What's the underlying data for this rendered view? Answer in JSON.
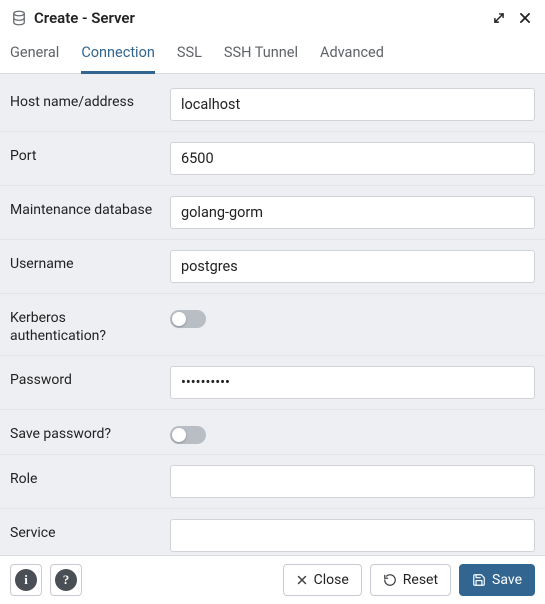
{
  "window": {
    "title": "Create - Server"
  },
  "tabs": [
    {
      "label": "General"
    },
    {
      "label": "Connection"
    },
    {
      "label": "SSL"
    },
    {
      "label": "SSH Tunnel"
    },
    {
      "label": "Advanced"
    }
  ],
  "form": {
    "host": {
      "label": "Host name/address",
      "value": "localhost"
    },
    "port": {
      "label": "Port",
      "value": "6500"
    },
    "maintdb": {
      "label": "Maintenance database",
      "value": "golang-gorm"
    },
    "username": {
      "label": "Username",
      "value": "postgres"
    },
    "kerberos": {
      "label": "Kerberos authentication?",
      "on": false
    },
    "password": {
      "label": "Password",
      "value": "••••••••••"
    },
    "savepw": {
      "label": "Save password?",
      "on": false
    },
    "role": {
      "label": "Role",
      "value": ""
    },
    "service": {
      "label": "Service",
      "value": ""
    }
  },
  "footer": {
    "close": "Close",
    "reset": "Reset",
    "save": "Save"
  }
}
